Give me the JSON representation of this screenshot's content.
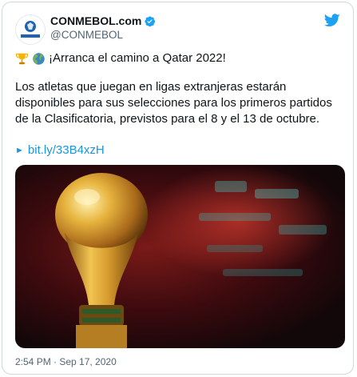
{
  "tweet": {
    "display_name": "CONMEBOL.com",
    "handle": "@CONMEBOL",
    "avatar_text": "CONMEBOL",
    "headline": "¡Arranca el camino a Qatar 2022!",
    "body": "Los atletas que juegan en ligas extranjeras estarán disponibles para sus selecciones para los primeros partidos de la Clasificatoria, previstos para el 8 y el 13 de octubre.",
    "link": "bit.ly/33B4xzH",
    "timestamp": "2:54 PM · Sep 17, 2020"
  },
  "icons": {
    "verified": "verified-badge-icon",
    "brand": "twitter-bird-icon",
    "emoji1": "trophy-icon",
    "emoji2": "globe-americas-icon",
    "link_prefix": "link-arrow-icon"
  },
  "colors": {
    "twitter_blue": "#1da1f2",
    "link_blue": "#1b95e0",
    "text": "#0f1419",
    "secondary": "#536471"
  },
  "media": {
    "subject": "photo of a golden trophy against a blurred red background"
  }
}
